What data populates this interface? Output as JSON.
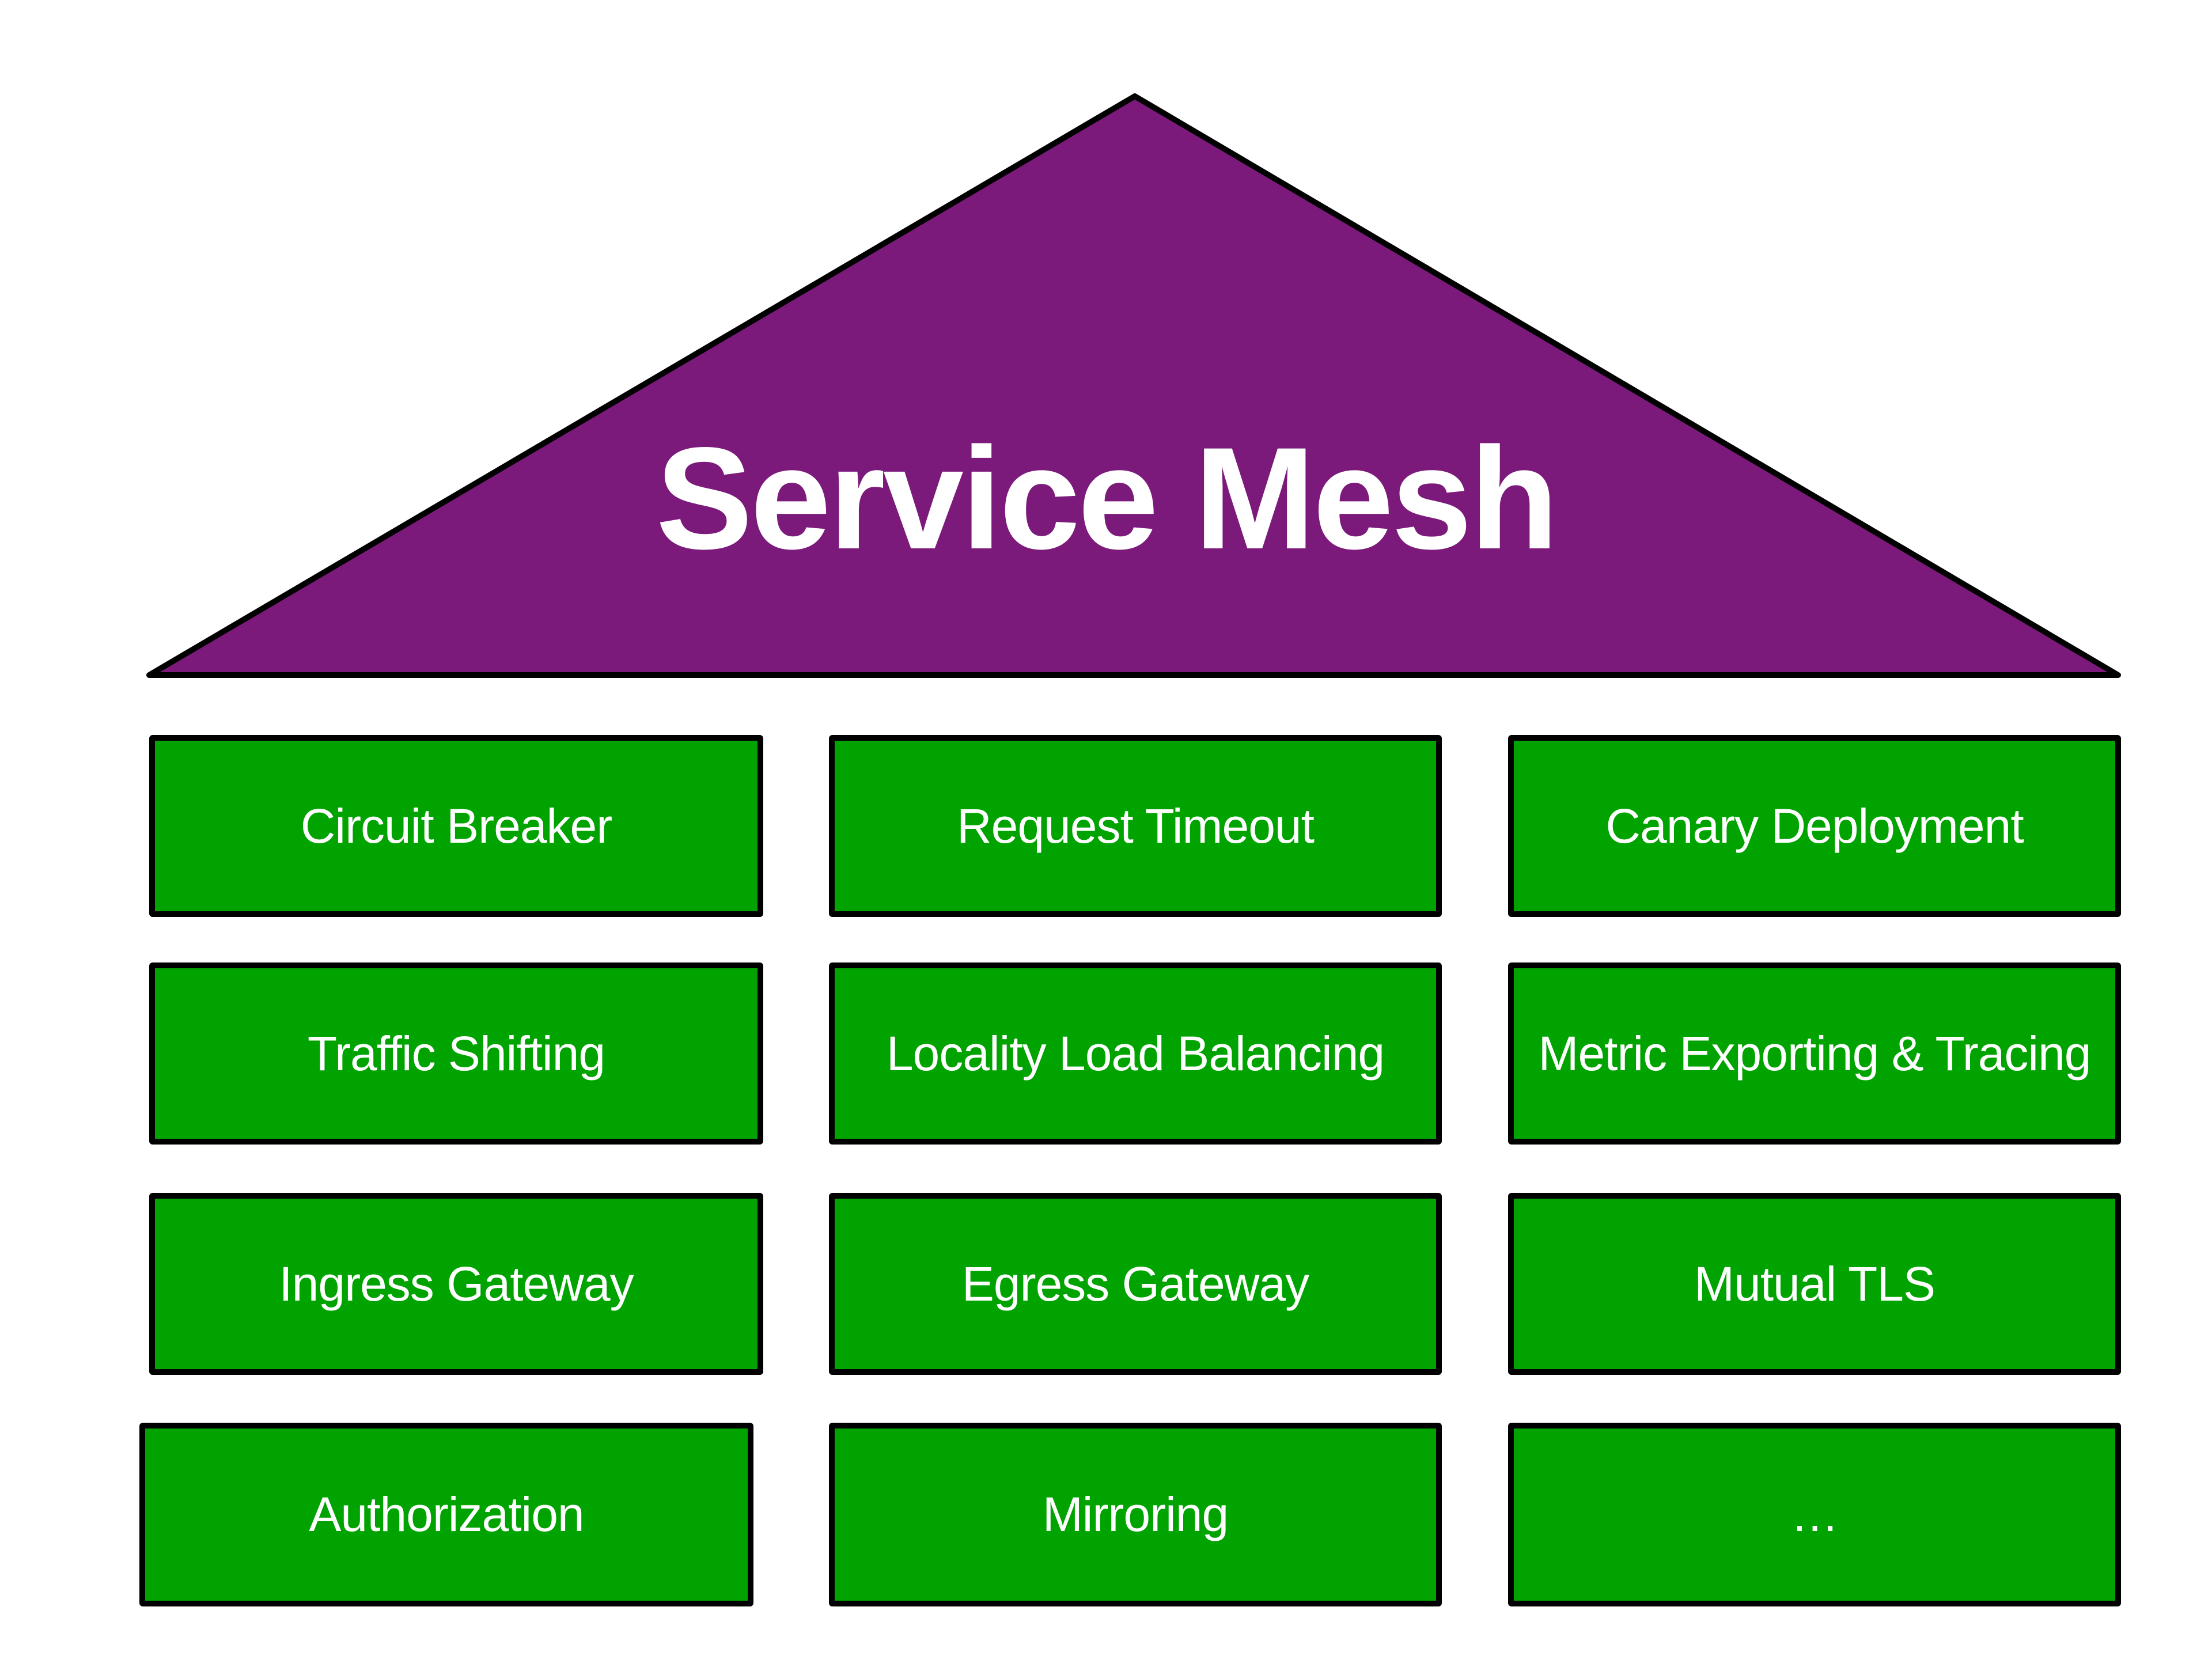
{
  "diagram": {
    "title": "Service Mesh",
    "colors": {
      "roof_fill": "#7b1a7b",
      "roof_stroke": "#000000",
      "box_fill": "#00a300",
      "box_border": "#000000",
      "text": "#ffffff"
    },
    "features": [
      [
        "Circuit Breaker",
        "Request Timeout",
        "Canary Deployment"
      ],
      [
        "Traffic Shifting",
        "Locality Load Balancing",
        "Metric Exporting & Tracing"
      ],
      [
        "Ingress Gateway",
        "Egress Gateway",
        "Mutual TLS"
      ],
      [
        "Authorization",
        "Mirroring",
        "…"
      ]
    ]
  }
}
